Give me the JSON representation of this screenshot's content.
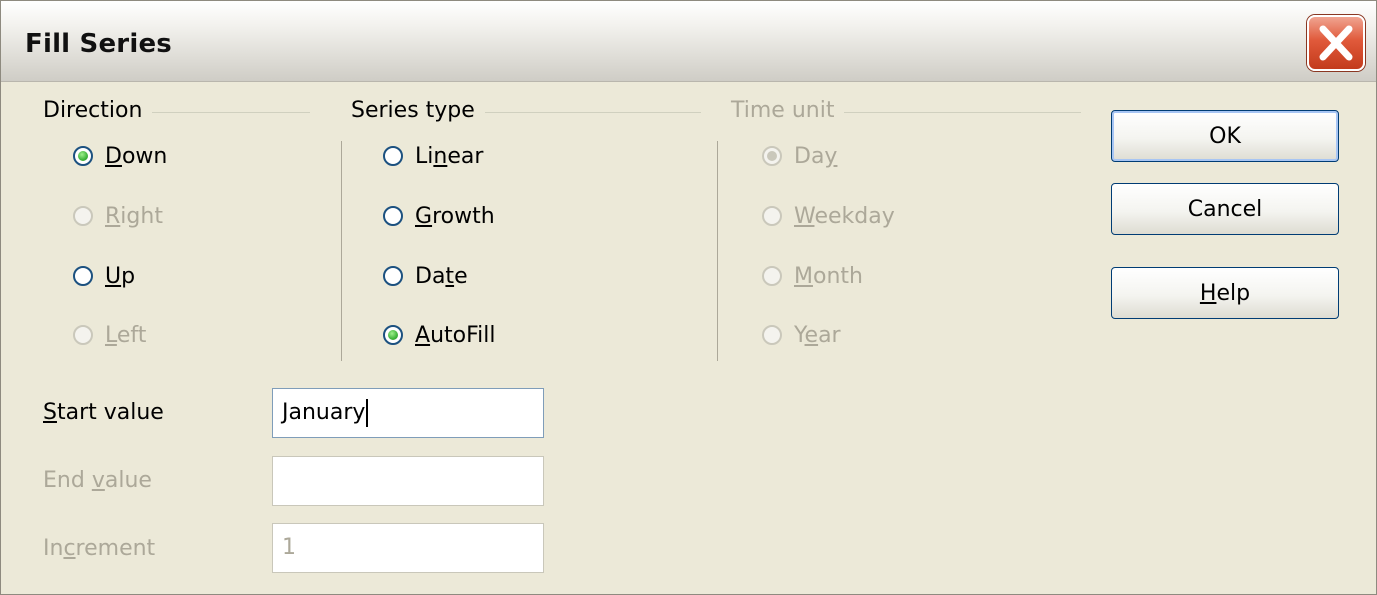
{
  "dialog": {
    "title": "Fill Series"
  },
  "direction": {
    "title": "Direction",
    "options": [
      {
        "pre": "",
        "u": "D",
        "post": "own",
        "checked": true,
        "disabled": false
      },
      {
        "pre": "",
        "u": "R",
        "post": "ight",
        "checked": false,
        "disabled": true
      },
      {
        "pre": "",
        "u": "U",
        "post": "p",
        "checked": false,
        "disabled": false
      },
      {
        "pre": "",
        "u": "L",
        "post": "eft",
        "checked": false,
        "disabled": true
      }
    ]
  },
  "series_type": {
    "title": "Series type",
    "options": [
      {
        "pre": "Li",
        "u": "n",
        "post": "ear",
        "checked": false,
        "disabled": false
      },
      {
        "pre": "",
        "u": "G",
        "post": "rowth",
        "checked": false,
        "disabled": false
      },
      {
        "pre": "Da",
        "u": "t",
        "post": "e",
        "checked": false,
        "disabled": false
      },
      {
        "pre": "",
        "u": "A",
        "post": "utoFill",
        "checked": true,
        "disabled": false
      }
    ]
  },
  "time_unit": {
    "title": "Time unit",
    "options": [
      {
        "pre": "Da",
        "u": "y",
        "post": "",
        "checked": true,
        "disabled": true
      },
      {
        "pre": "",
        "u": "W",
        "post": "eekday",
        "checked": false,
        "disabled": true
      },
      {
        "pre": "",
        "u": "M",
        "post": "onth",
        "checked": false,
        "disabled": true
      },
      {
        "pre": "Y",
        "u": "e",
        "post": "ar",
        "checked": false,
        "disabled": true
      }
    ]
  },
  "fields": {
    "start": {
      "label_pre": "",
      "label_u": "S",
      "label_post": "tart value",
      "value": "January"
    },
    "end": {
      "label_pre": "End ",
      "label_u": "v",
      "label_post": "alue",
      "value": ""
    },
    "increment": {
      "label_pre": "In",
      "label_u": "c",
      "label_post": "rement",
      "value": "1"
    }
  },
  "buttons": {
    "ok": {
      "pre": "OK",
      "u": "",
      "post": ""
    },
    "cancel": {
      "pre": "Cancel",
      "u": "",
      "post": ""
    },
    "help": {
      "pre": "",
      "u": "H",
      "post": "elp"
    }
  },
  "colors": {
    "dialog_bg": "#ece9d8",
    "radio_checked": "#3fb43a",
    "disabled_text": "#aca899",
    "close_button": "#e0593a"
  },
  "icons": {
    "close": "close-icon"
  }
}
